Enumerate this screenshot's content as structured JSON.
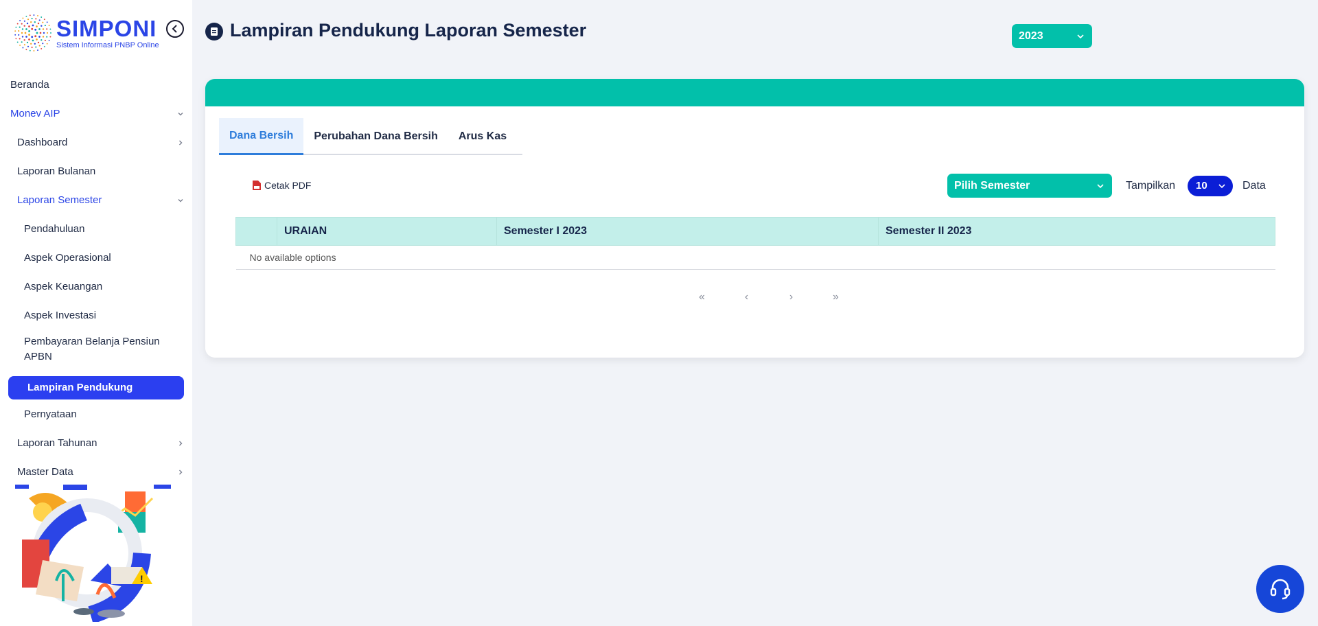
{
  "app": {
    "logo_title": "SIMPONI",
    "logo_subtitle": "Sistem Informasi PNBP Online"
  },
  "sidebar": {
    "items": [
      {
        "label": "Beranda",
        "level": 0,
        "state": "normal",
        "chevron": "none"
      },
      {
        "label": "Monev AIP",
        "level": 0,
        "state": "blue",
        "chevron": "down"
      },
      {
        "label": "Dashboard",
        "level": 1,
        "state": "normal",
        "chevron": "right"
      },
      {
        "label": "Laporan Bulanan",
        "level": 1,
        "state": "normal",
        "chevron": "none"
      },
      {
        "label": "Laporan Semester",
        "level": 1,
        "state": "blue",
        "chevron": "down"
      },
      {
        "label": "Pendahuluan",
        "level": 2,
        "state": "normal",
        "chevron": "none"
      },
      {
        "label": "Aspek Operasional",
        "level": 2,
        "state": "normal",
        "chevron": "none"
      },
      {
        "label": "Aspek Keuangan",
        "level": 2,
        "state": "normal",
        "chevron": "none"
      },
      {
        "label": "Aspek Investasi",
        "level": 2,
        "state": "normal",
        "chevron": "none"
      },
      {
        "label": "Pembayaran Belanja Pensiun APBN",
        "level": 2,
        "state": "normal",
        "chevron": "none"
      },
      {
        "label": "Lampiran Pendukung",
        "level": 2,
        "state": "active",
        "chevron": "none"
      },
      {
        "label": "Pernyataan",
        "level": 2,
        "state": "normal",
        "chevron": "none"
      },
      {
        "label": "Laporan Tahunan",
        "level": 1,
        "state": "normal",
        "chevron": "right"
      },
      {
        "label": "Master Data",
        "level": 1,
        "state": "normal",
        "chevron": "right"
      }
    ]
  },
  "header": {
    "title": "Lampiran Pendukung Laporan Semester",
    "year_value": "2023"
  },
  "tabs": [
    {
      "label": "Dana Bersih",
      "active": true
    },
    {
      "label": "Perubahan Dana Bersih",
      "active": false
    },
    {
      "label": "Arus Kas",
      "active": false
    }
  ],
  "toolbar": {
    "cetak_label": "Cetak PDF",
    "semester_placeholder": "Pilih Semester",
    "tampilkan_label": "Tampilkan",
    "page_size": "10",
    "data_label": "Data"
  },
  "table": {
    "columns": [
      "",
      "URAIAN",
      "Semester I 2023",
      "Semester II 2023"
    ],
    "empty_text": "No available options"
  },
  "pager": {
    "first": "«",
    "prev": "‹",
    "next": "›",
    "last": "»"
  },
  "colors": {
    "brand_blue": "#2b45e6",
    "teal": "#02c0aa",
    "active_nav": "#2b3ff0",
    "help_button": "#1646d8"
  }
}
